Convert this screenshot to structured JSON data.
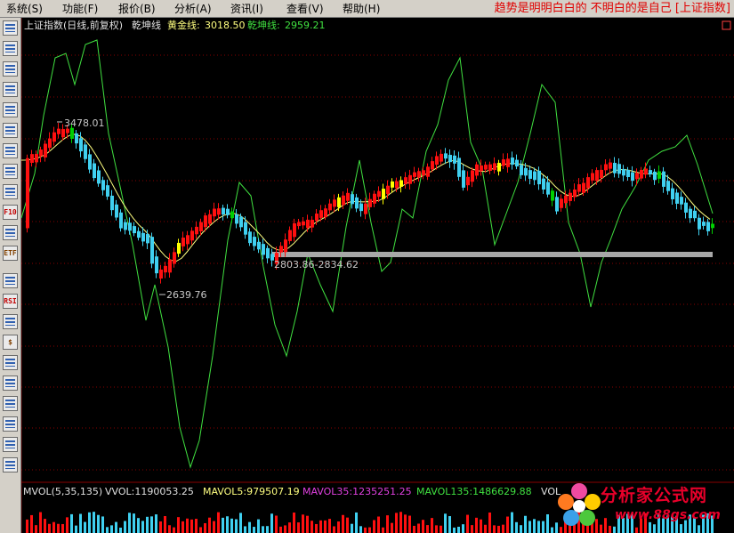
{
  "menu": {
    "items": [
      "系统(S)",
      "功能(F)",
      "报价(B)",
      "分析(A)",
      "资讯(I)",
      "查看(V)",
      "帮助(H)"
    ],
    "slogan": "趋势是明明白白的  不明白的是自己 [上证指数]"
  },
  "toolbar": {
    "icons": [
      "quote-list-icon",
      "report-table-icon",
      "line-chart-icon",
      "candle-chart-icon",
      "sector-table-icon",
      "board-table-icon",
      "compare-icon",
      "mail-icon",
      "users-icon",
      "f10-info-icon",
      "zoom-icon",
      "etf-icon",
      "wave-indicator-icon",
      "rsi-indicator-icon",
      "formula-icon",
      "money-icon",
      "tools-icon",
      "export-icon",
      "pencil-icon",
      "move-cross-icon",
      "arrow-up-icon",
      "arrow-down-icon"
    ],
    "labels": {
      "f10-info-icon": "F10",
      "etf-icon": "ETF",
      "rsi-indicator-icon": "RSI",
      "money-icon": "$"
    }
  },
  "header": {
    "instrument": "上证指数(日线,前复权)",
    "indicator": "乾坤线",
    "gold_label": "黄金线:",
    "gold_value": "3018.50",
    "qk_label": "乾坤线:",
    "qk_value": "2959.21"
  },
  "annotations": {
    "high": "3478.01",
    "low": "2639.76",
    "range": "2803.86-2834.62"
  },
  "volume": {
    "title": "MVOL(5,35,135)",
    "vvol": "VVOL:1190053.25",
    "mavol5": "MAVOL5:979507.19",
    "mavol35": "MAVOL35:1235251.25",
    "mavol135": "MAVOL135:1486629.88",
    "trailing": "VOL"
  },
  "logo": {
    "text": "分析家公式网",
    "url": "www.88gs.com"
  },
  "colors": {
    "up": "#ff1010",
    "down": "#40d0f0",
    "limit_up": "#ffff00",
    "limit_down": "#00d000",
    "gold_line": "#ffff80",
    "qk_line": "#40e040",
    "grid": "#880000",
    "support_band": "#a8a8a8",
    "mavol35": "#e040e0",
    "mavol135": "#40e040"
  }
}
